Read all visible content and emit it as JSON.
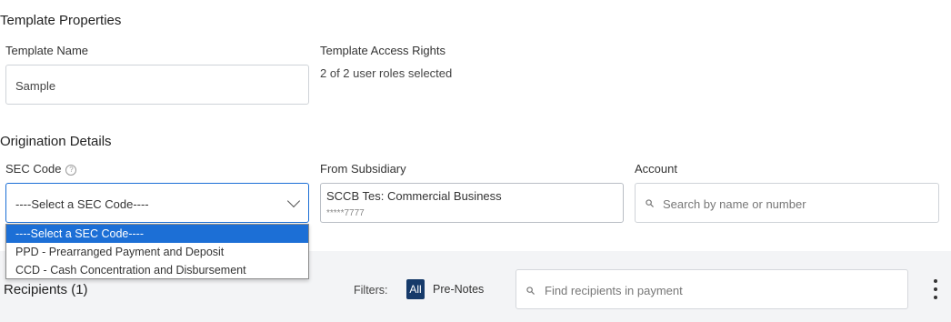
{
  "template_properties": {
    "title": "Template Properties",
    "name_label": "Template Name",
    "name_value": "Sample",
    "access_label": "Template Access Rights",
    "access_value": "2 of 2 user roles selected"
  },
  "origination": {
    "title": "Origination Details",
    "sec_code_label": "SEC Code",
    "help_icon": "question-circle-icon",
    "sec_code_selected": "----Select a SEC Code----",
    "sec_code_options": [
      "----Select a SEC Code----",
      "PPD - Prearranged Payment and Deposit",
      "CCD - Cash Concentration and Disbursement"
    ],
    "from_subsidiary_label": "From Subsidiary",
    "subsidiary_name": "SCCB Tes: Commercial Business",
    "subsidiary_account": "*****7777",
    "account_label": "Account",
    "account_placeholder": "Search by name or number"
  },
  "recipients": {
    "title": "Recipients (1)",
    "filters_label": "Filters:",
    "filter_all": "All",
    "filter_prenotes": "Pre-Notes",
    "search_placeholder": "Find recipients in payment",
    "more_icon": "kebab-menu-icon"
  },
  "colors": {
    "accent": "#1c6fd6",
    "pill": "#163a6a",
    "band": "#f3f4f6"
  }
}
